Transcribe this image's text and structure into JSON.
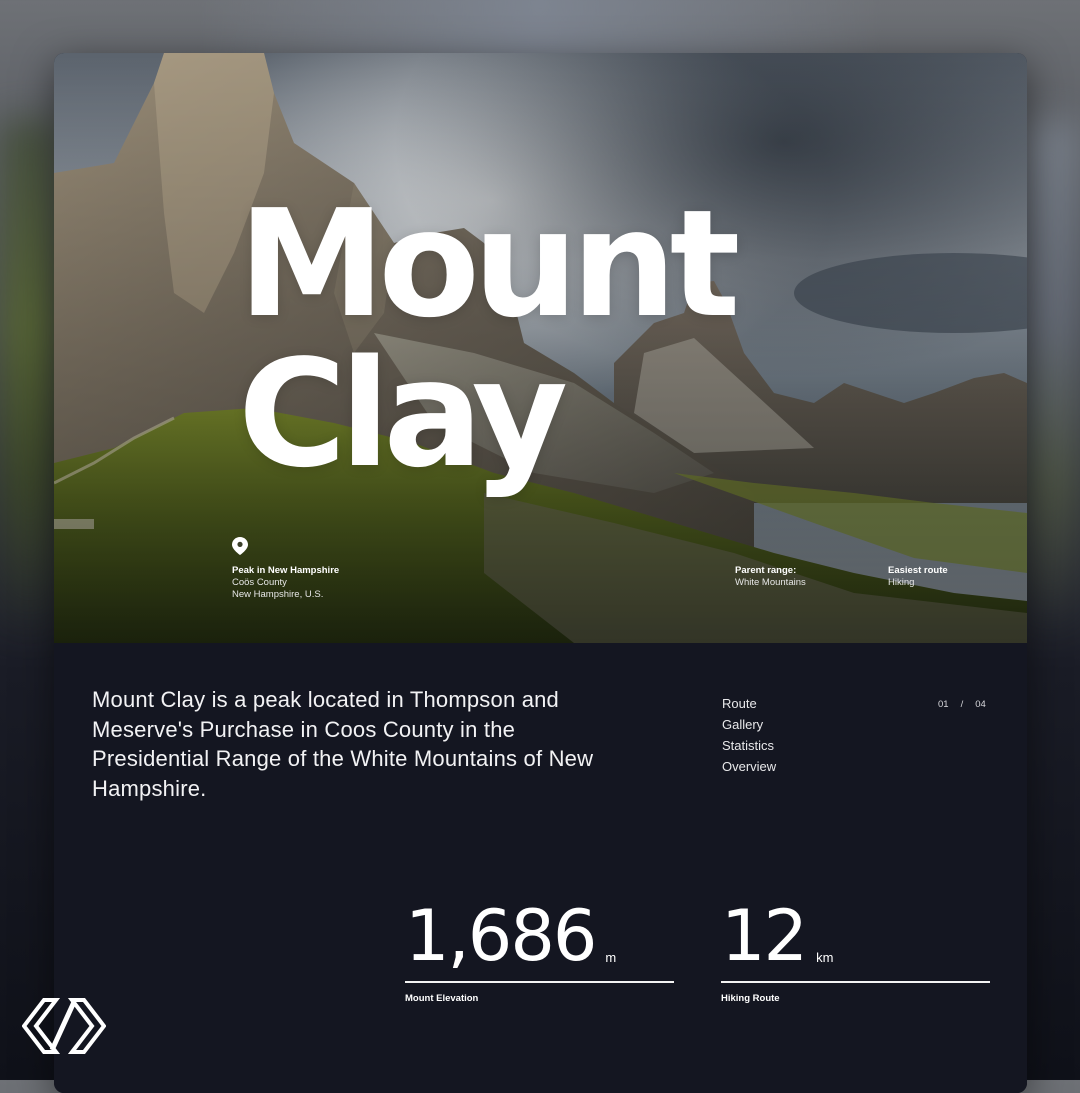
{
  "hero": {
    "title_line1": "Mount",
    "title_line2": "Clay"
  },
  "location": {
    "icon": "location-pin-icon",
    "heading": "Peak in New Hampshire",
    "line1": "Coös County",
    "line2": "New Hampshire, U.S."
  },
  "parent_range": {
    "label": "Parent range:",
    "value": "White Mountains"
  },
  "easiest_route": {
    "label": "Easiest route",
    "value": "Hiking"
  },
  "description": "Mount Clay is a peak located in Thompson and Meserve's Purchase in Coos County in the Presidential Range of the White Mountains of New Hampshire.",
  "nav": {
    "items": [
      "Route",
      "Gallery",
      "Statistics",
      "Overview"
    ]
  },
  "pager": {
    "current": "01",
    "separator": "/",
    "total": "04"
  },
  "stats": {
    "elevation": {
      "value": "1,686",
      "unit": "m",
      "label": "Mount Elevation"
    },
    "route": {
      "value": "12",
      "unit": "km",
      "label": "Hiking Route"
    }
  },
  "brand": {
    "icon": "brand-logo-icon"
  },
  "colors": {
    "background": "#141621",
    "text": "#ffffff"
  }
}
